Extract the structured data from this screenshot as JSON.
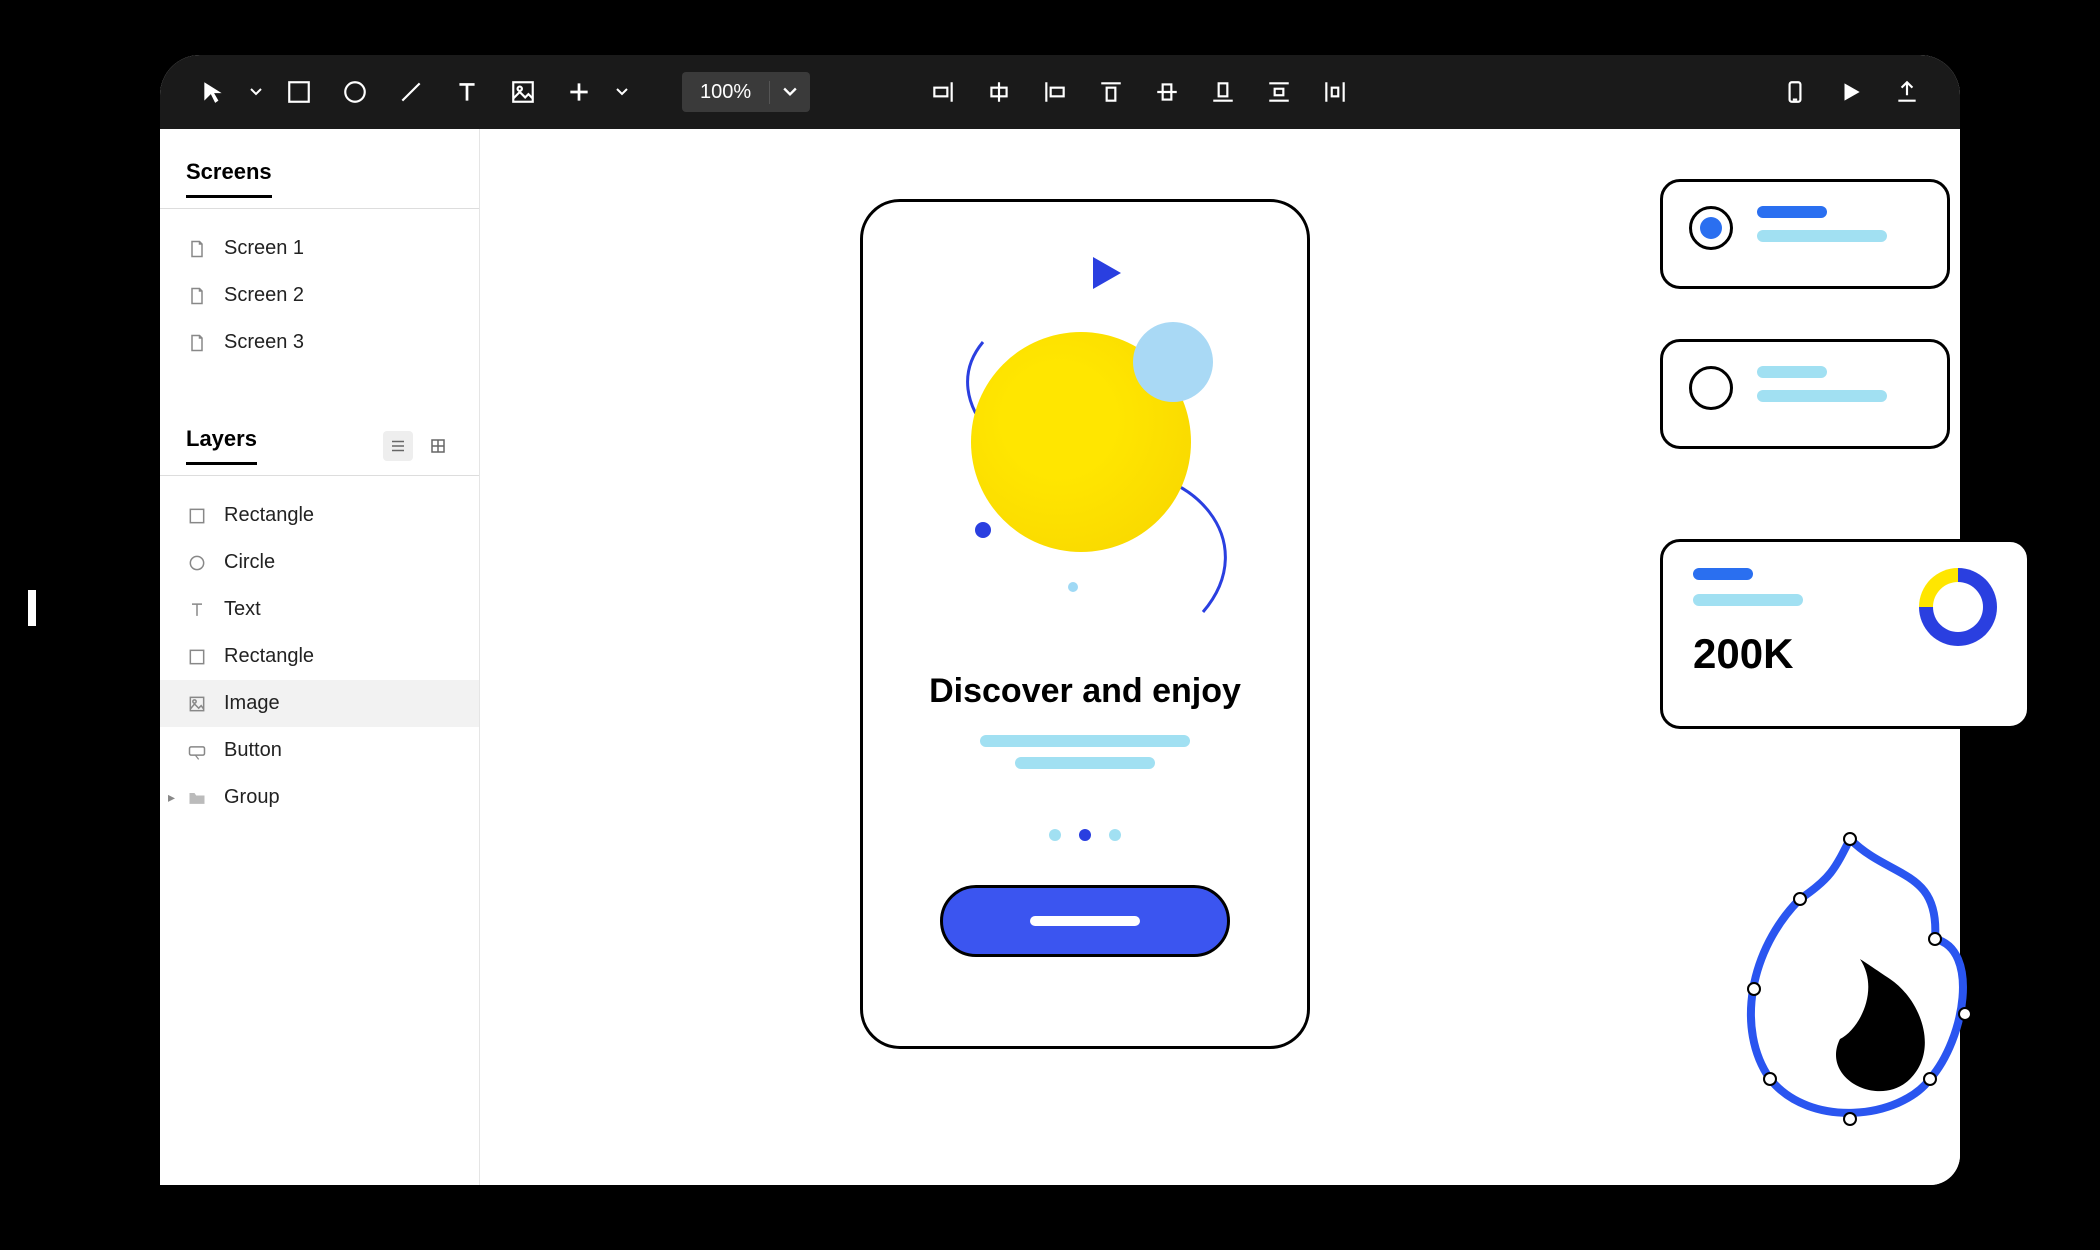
{
  "toolbar": {
    "zoom": "100%"
  },
  "sidebar": {
    "screens_title": "Screens",
    "screens": [
      {
        "label": "Screen 1"
      },
      {
        "label": "Screen 2"
      },
      {
        "label": "Screen 3"
      }
    ],
    "layers_title": "Layers",
    "layers": [
      {
        "label": "Rectangle",
        "icon": "rect"
      },
      {
        "label": "Circle",
        "icon": "circle"
      },
      {
        "label": "Text",
        "icon": "text"
      },
      {
        "label": "Rectangle",
        "icon": "rect"
      },
      {
        "label": "Image",
        "icon": "image",
        "selected": true
      },
      {
        "label": "Button",
        "icon": "button"
      },
      {
        "label": "Group",
        "icon": "folder",
        "expandable": true
      }
    ]
  },
  "canvas": {
    "phone": {
      "title": "Discover and enjoy"
    },
    "stat_card": {
      "metric": "200K"
    }
  },
  "colors": {
    "accent_blue": "#2a3fe0",
    "light_blue": "#a1e0f2",
    "yellow": "#ffe600"
  }
}
